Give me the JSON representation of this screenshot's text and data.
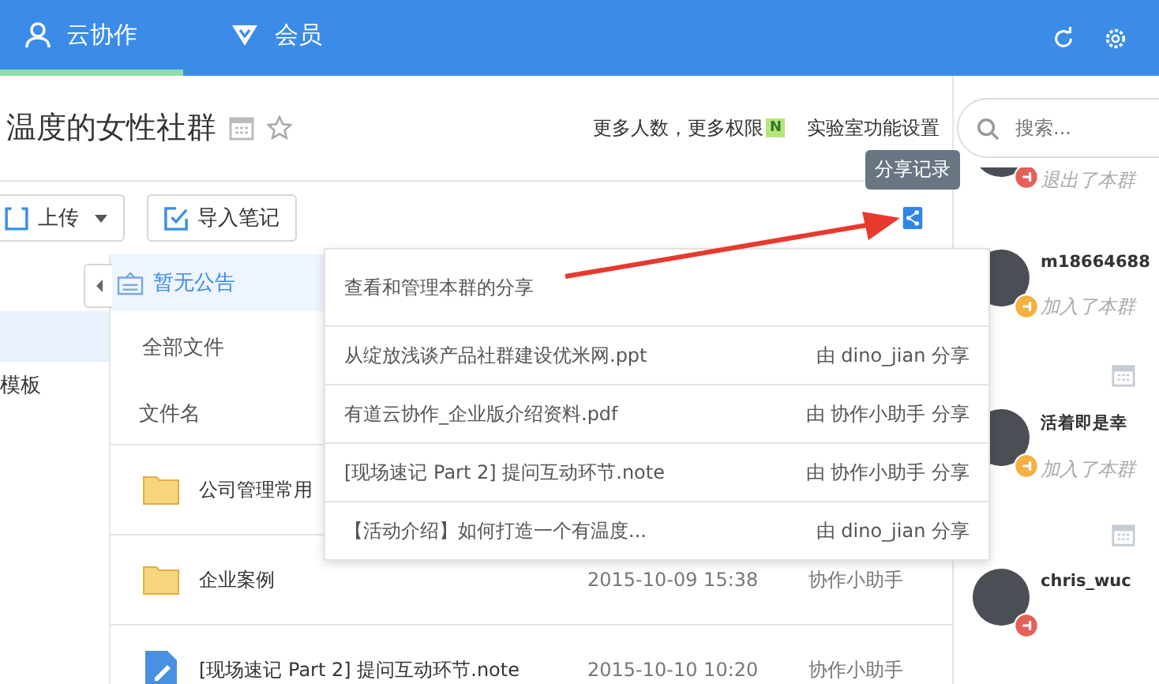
{
  "nav": {
    "tabs": [
      {
        "label": "云协作",
        "selected": true
      },
      {
        "label": "会员",
        "selected": false
      }
    ]
  },
  "header": {
    "title": "温度的女性社群",
    "upgrade_link": "更多人数，更多权限",
    "upgrade_badge": "N",
    "lab_link": "实验室功能设置",
    "search": {
      "placeholder": "搜索..."
    }
  },
  "toolbar": {
    "upload_button": "上传",
    "import_button": "导入笔记",
    "share_tooltip": "分享记录"
  },
  "sidebar": {
    "items": [
      {
        "selected": true
      },
      {
        "label": "模板",
        "selected": false
      }
    ]
  },
  "notice": "暂无公告",
  "breadcrumb": "全部文件",
  "table": {
    "columns": [
      "文件名"
    ],
    "rows": [
      {
        "kind": "folder",
        "name": "公司管理常用"
      },
      {
        "kind": "folder",
        "name": "企业案例",
        "time": "2015-10-09 15:38",
        "author": "协作小助手"
      },
      {
        "kind": "note",
        "name": "[现场速记 Part 2] 提问互动环节.note",
        "time": "2015-10-10 10:20",
        "author": "协作小助手"
      }
    ]
  },
  "share_popup": {
    "heading": "查看和管理本群的分享",
    "items": [
      {
        "file": "从绽放浅谈产品社群建设优米网.ppt",
        "sharer": "由 dino_jian 分享"
      },
      {
        "file": "有道云协作_企业版介绍资料.pdf",
        "sharer": "由 协作小助手 分享"
      },
      {
        "file": "[现场速记 Part 2] 提问互动环节.note",
        "sharer": "由 协作小助手 分享"
      },
      {
        "file": "【活动介绍】如何打造一个有温度...",
        "sharer": "由 dino_jian 分享"
      }
    ]
  },
  "activity": [
    {
      "kind": "exit",
      "action": "退出了本群"
    },
    {
      "kind": "join",
      "name": "m18664688",
      "action": "加入了本群"
    },
    {
      "kind": "date"
    },
    {
      "kind": "join",
      "name": "活着即是幸",
      "action": "加入了本群"
    },
    {
      "kind": "date"
    },
    {
      "kind": "exit",
      "name": "chris_wuc"
    }
  ]
}
